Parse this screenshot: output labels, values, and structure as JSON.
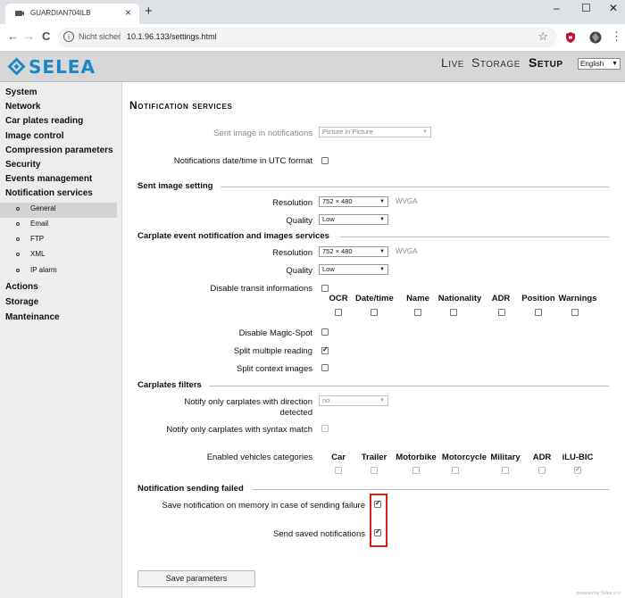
{
  "browser": {
    "tab_title": "GUARDIAN704ILB",
    "tab_close": "×",
    "new_tab": "+",
    "minimize": "–",
    "maximize": "☐",
    "close": "✕",
    "back": "←",
    "forward": "→",
    "reload": "C",
    "info": "i",
    "insecure_label": "Nicht sicher",
    "separator": "|",
    "url": "10.1.96.133/settings.html",
    "bookmark": "☆",
    "menu": "⋮"
  },
  "header": {
    "logo_text": "SELEA",
    "brand_color": "#1b87c6",
    "nav": [
      {
        "label": "Live",
        "active": false
      },
      {
        "label": "Storage",
        "active": false
      },
      {
        "label": "Setup",
        "active": true
      }
    ],
    "language": "English",
    "lang_arrow": "▼"
  },
  "sidebar": {
    "items": [
      {
        "label": "System"
      },
      {
        "label": "Network"
      },
      {
        "label": "Car plates reading"
      },
      {
        "label": "Image control"
      },
      {
        "label": "Compression parameters"
      },
      {
        "label": "Security"
      },
      {
        "label": "Events management"
      },
      {
        "label": "Notification services"
      }
    ],
    "subitems": [
      {
        "label": "General",
        "active": true
      },
      {
        "label": "Email",
        "active": false
      },
      {
        "label": "FTP",
        "active": false
      },
      {
        "label": "XML",
        "active": false
      },
      {
        "label": "IP alarm",
        "active": false
      }
    ],
    "after_items": [
      {
        "label": "Actions"
      },
      {
        "label": "Storage"
      },
      {
        "label": "Manteinance"
      }
    ]
  },
  "main": {
    "title": "Notification services",
    "sent_image": {
      "label": "Sent image in notifications",
      "value": "Picture in Picture"
    },
    "utc": {
      "label": "Notifications date/time in UTC format",
      "checked": false
    },
    "sent_image_setting": {
      "title": "Sent image setting",
      "resolution_label": "Resolution",
      "resolution": "752 × 480",
      "resolution_suffix": "WVGA",
      "quality_label": "Quality",
      "quality": "Low"
    },
    "carplate_event": {
      "title": "Carplate event notification and images services",
      "resolution_label": "Resolution",
      "resolution": "752 × 480",
      "resolution_suffix": "WVGA",
      "quality_label": "Quality",
      "quality": "Low",
      "disable_transit_label": "Disable transit informations",
      "disable_transit_checked": false,
      "columns": [
        "OCR",
        "Date/time",
        "Name",
        "Nationality",
        "ADR",
        "Position",
        "Warnings"
      ],
      "disable_magic_label": "Disable Magic-Spot",
      "disable_magic_checked": false,
      "split_multiple_label": "Split multiple reading",
      "split_multiple_checked": true,
      "split_context_label": "Split context images",
      "split_context_checked": false
    },
    "carplates_filters": {
      "title": "Carplates filters",
      "direction_label_1": "Notify only carplates with direction",
      "direction_label_2": "detected",
      "direction_value": "no",
      "syntax_label": "Notify only carplates with syntax match",
      "syntax_checked": false,
      "categories_label": "Enabled vehicles categories",
      "categories": [
        {
          "label": "Car",
          "checked": false
        },
        {
          "label": "Trailer",
          "checked": false
        },
        {
          "label": "Motorbike",
          "checked": false
        },
        {
          "label": "Motorcycle",
          "checked": false
        },
        {
          "label": "Military",
          "checked": false
        },
        {
          "label": "ADR",
          "checked": false
        },
        {
          "label": "iLU-BIC",
          "checked": true
        }
      ]
    },
    "sending_failed": {
      "title": "Notification sending failed",
      "save_label": "Save notification on memory in case of sending failure",
      "save_checked": true,
      "send_label": "Send saved notifications",
      "send_checked": true
    },
    "save_button": "Save parameters",
    "footer": "powered by Selea s.r.l."
  },
  "colors": {
    "highlight": "#e01b1b",
    "sidebar_bg": "#ededed",
    "header_bg": "#d7d7d7"
  }
}
